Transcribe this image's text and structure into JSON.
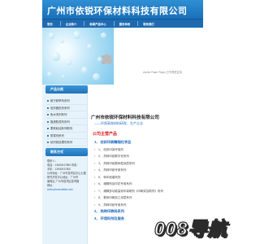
{
  "header": {
    "title": "广州市依锐环保材料科技有限公司"
  },
  "nav": {
    "items": [
      "首页",
      "企业简介",
      "新闻产品中心",
      "服务体系",
      "联系我们"
    ]
  },
  "banner": {
    "plugin_text": "Adobe Flash Player 已不再受支持"
  },
  "sidebar": {
    "heading": "产品分类",
    "items": [
      "耐汗耐旱剂系列",
      "色剂固色剂系列",
      "免水洗剂系列",
      "阻燃防泼剂系列",
      "柔软硅油系列助剂",
      "防霉剂系列",
      "纺织前处理剂系列"
    ],
    "contact_heading": "联系方式",
    "contact_lines": [
      "联系人：",
      "电话：13600047884 传真：",
      "手机：13600047800",
      "",
      "公司地址：广州市荔湾区中山七路",
      "研究开发中心地址：广州市",
      "番禺区 广州市荔湾区荔湾路",
      "网址："
    ],
    "url": "www.yiruoxcailiao.com"
  },
  "main": {
    "company": "广州市依锐环保材料科技有限公司",
    "slogan": "——环保高效材料研发、生产企业",
    "products_heading": "公司主营产品",
    "products": [
      {
        "text": "1、 纺织印刷精细化学品",
        "cat": true
      },
      {
        "text": "1、 纺织印染环保剂",
        "cat": false
      },
      {
        "text": "2、 热转印纸数字化系列",
        "cat": false
      },
      {
        "text": "3、 热转印纸数码型涂层系列",
        "cat": false
      },
      {
        "text": "4、 热转印纸专用系列",
        "cat": false
      },
      {
        "text": "5、 转印纸增效剂",
        "cat": false
      },
      {
        "text": "6、 增稠剂及印花专用系列",
        "cat": false
      },
      {
        "text": "7、 增稠多功能高效印染助剂《印刷浆及助剂》系列",
        "cat": false
      },
      {
        "text": "8、 数码印刷加工涂层系列",
        "cat": false
      },
      {
        "text": "9、 热转印纸专用系列",
        "cat": false
      },
      {
        "text": "2、 热转印数码系列",
        "cat": true
      },
      {
        "text": "3、 环境科剂及服务",
        "cat": true
      }
    ]
  },
  "watermark": {
    "text": "008导航"
  },
  "colors": {
    "header": "#1a70b8",
    "nav": "#1f6ab0",
    "accent_red": "#dd2222",
    "link_blue": "#1a6ac2",
    "sidebar_bg": "#e7f3fb"
  }
}
